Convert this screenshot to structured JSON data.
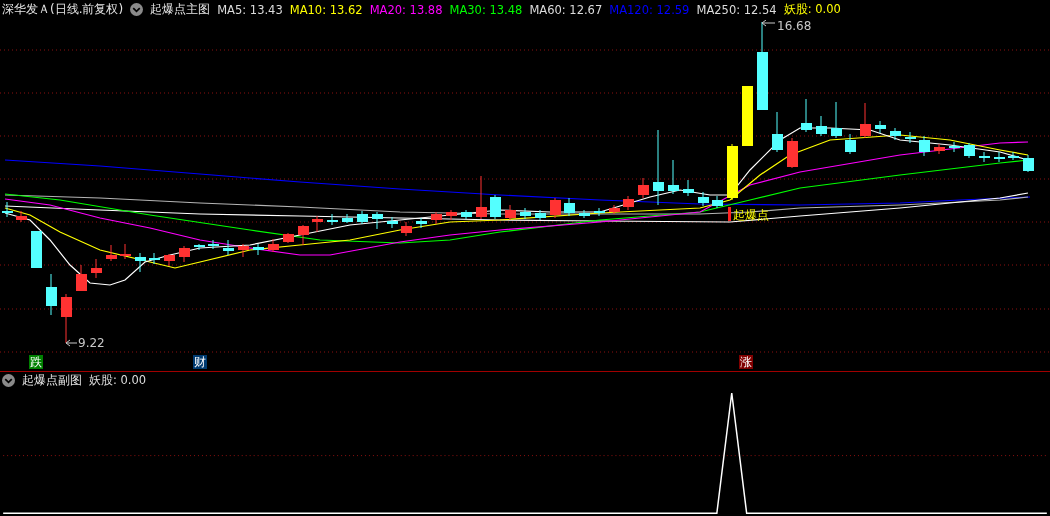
{
  "header": {
    "title": "深华发Ａ(日线.前复权)",
    "indicator": "起爆点主图"
  },
  "legend": [
    {
      "label": "MA5: 13.43",
      "color": "#dcdcdc"
    },
    {
      "label": "MA10: 13.62",
      "color": "#ffff00"
    },
    {
      "label": "MA20: 13.88",
      "color": "#ff00ff"
    },
    {
      "label": "MA30: 13.48",
      "color": "#00ff00"
    },
    {
      "label": "MA60: 12.67",
      "color": "#dcdcdc"
    },
    {
      "label": "MA120: 12.59",
      "color": "#0000ff"
    },
    {
      "label": "MA250: 12.54",
      "color": "#dcdcdc"
    },
    {
      "label": "妖股: 0.00",
      "color": "#ffff00"
    }
  ],
  "price_marks": {
    "high": "16.68",
    "low": "9.22"
  },
  "breakout_label": "起爆点",
  "signals": [
    {
      "label": "跌",
      "color": "#008000"
    },
    {
      "label": "财",
      "color": "#003a70"
    },
    {
      "label": "涨",
      "color": "#800000"
    }
  ],
  "sub_panel": {
    "indicator": "起爆点副图",
    "legend": [
      {
        "label": "妖股: 0.00",
        "color": "#dcdcdc"
      }
    ]
  }
}
